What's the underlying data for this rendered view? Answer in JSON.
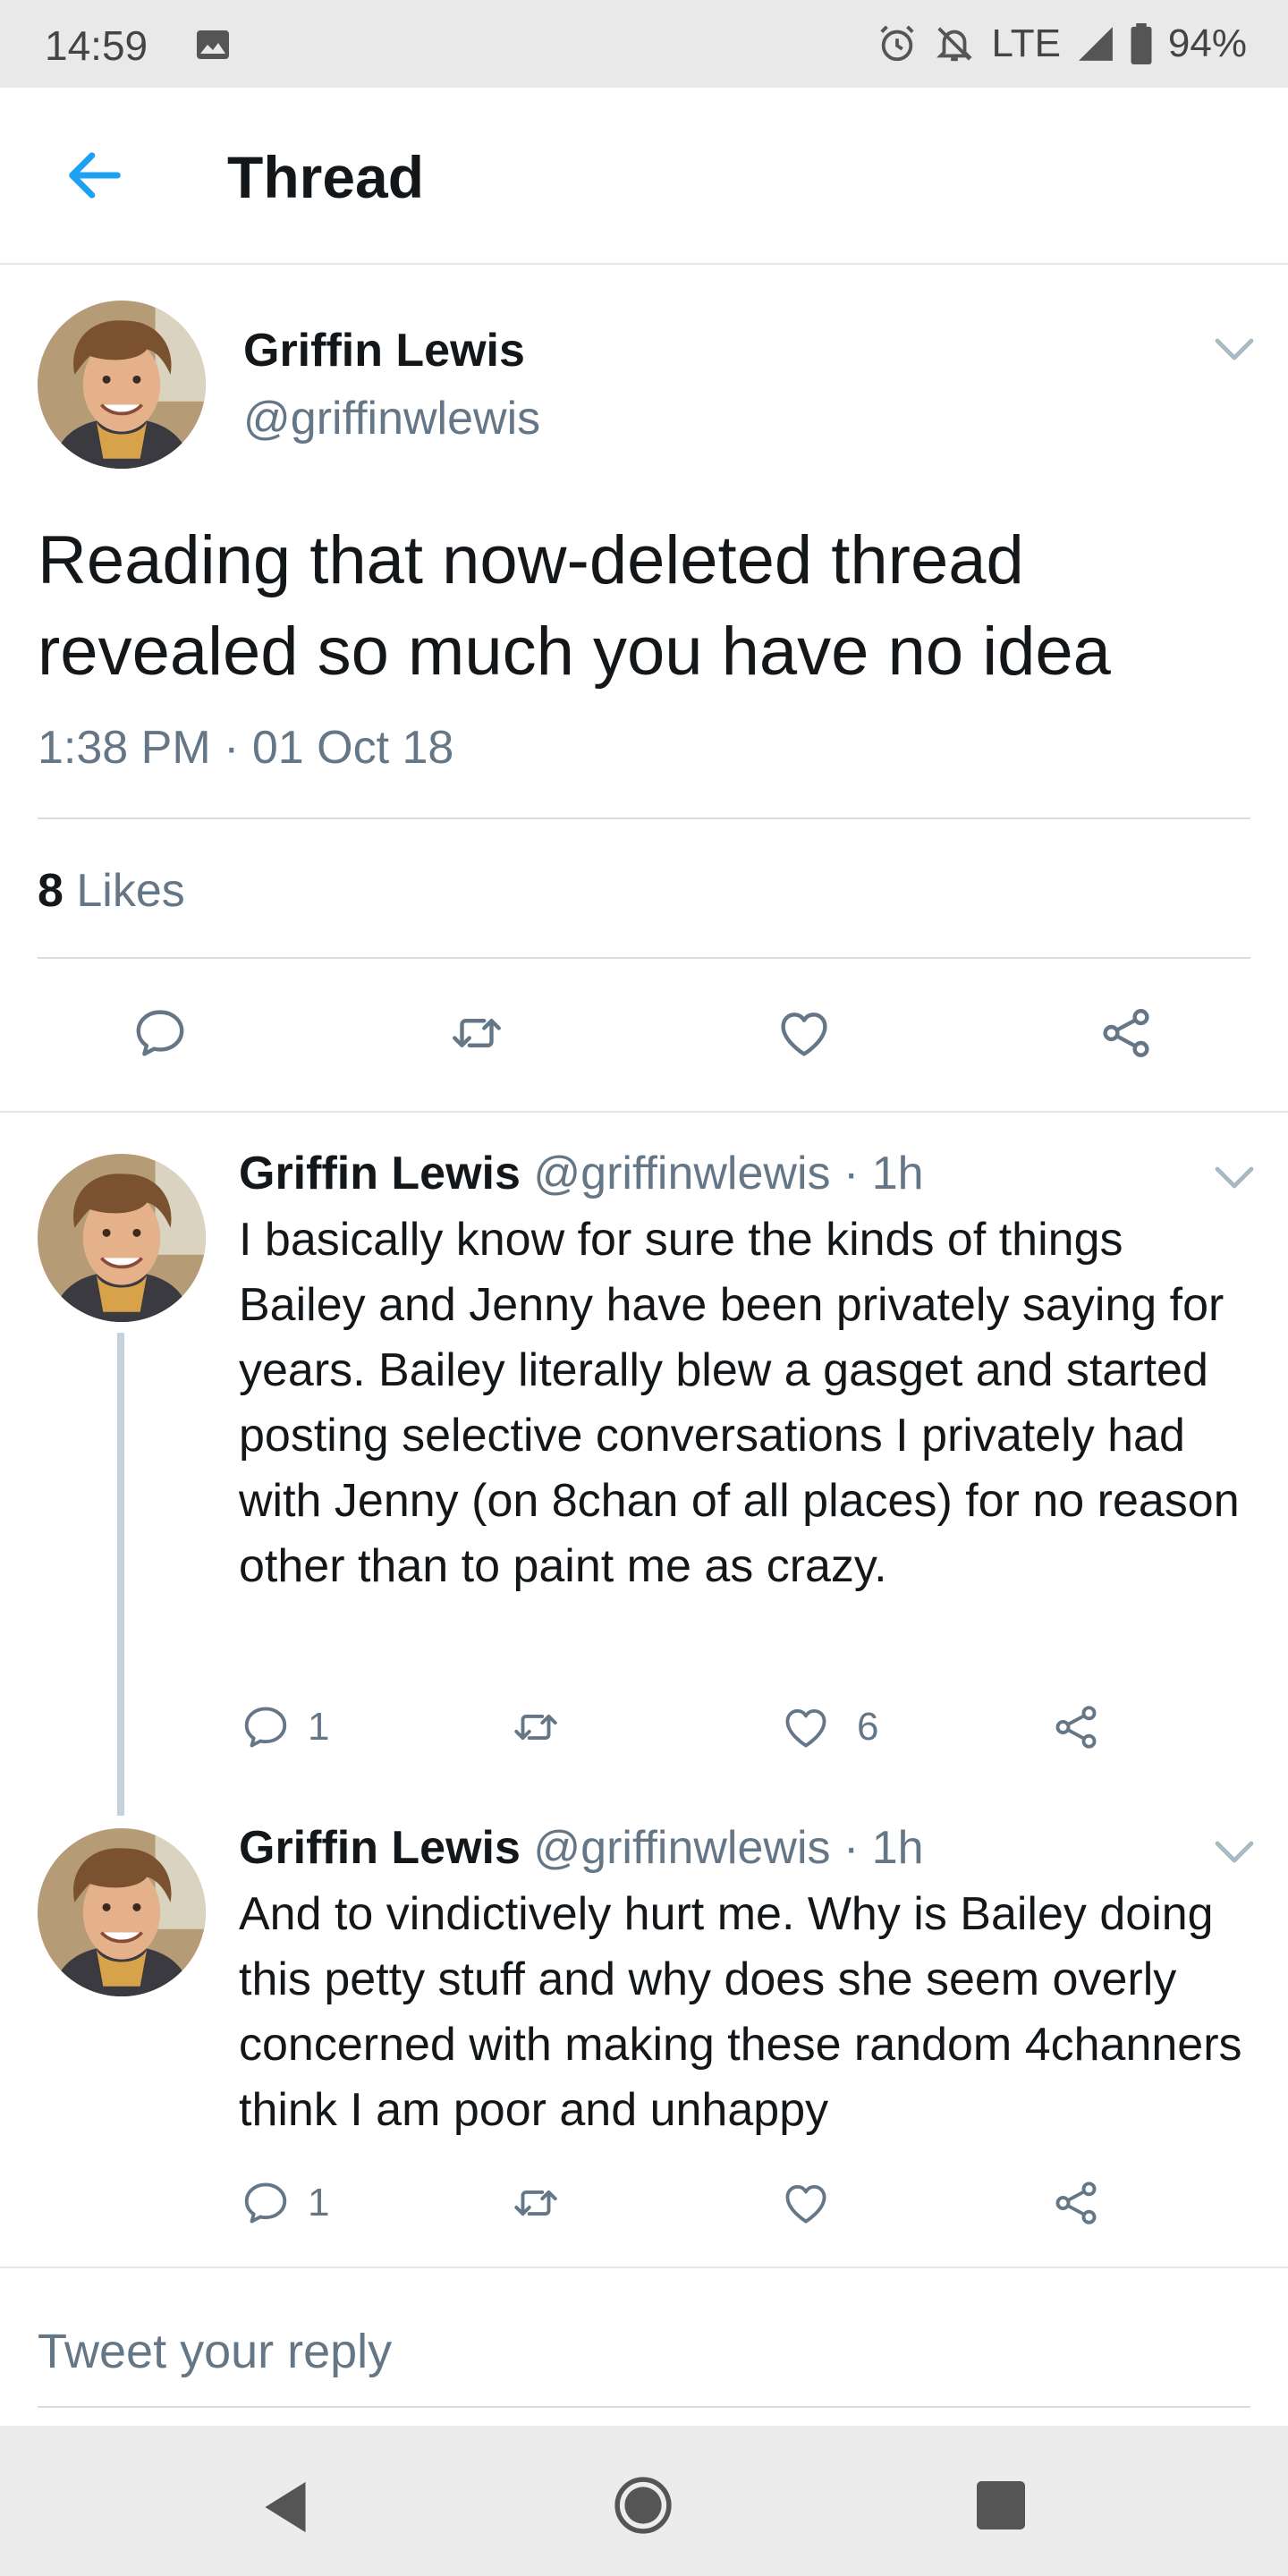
{
  "status_bar": {
    "time": "14:59",
    "network": "LTE",
    "battery": "94%"
  },
  "app_bar": {
    "title": "Thread"
  },
  "main_tweet": {
    "name": "Griffin Lewis",
    "handle": "@griffinwlewis",
    "text": "Reading that now-deleted thread revealed so much you have no idea",
    "timestamp": "1:38 PM · 01 Oct 18",
    "likes_count": "8",
    "likes_label": "Likes"
  },
  "replies": [
    {
      "name": "Griffin Lewis",
      "handle": "@griffinwlewis",
      "time": "· 1h",
      "text": "I basically know for sure the kinds of things Bailey and Jenny have been privately saying for years. Bailey literally blew a gasget and started posting selective conversations I privately had with Jenny (on 8chan of all places) for no reason other than to paint me as crazy.",
      "reply_count": "1",
      "like_count": "6"
    },
    {
      "name": "Griffin Lewis",
      "handle": "@griffinwlewis",
      "time": "· 1h",
      "text": "And to vindictively hurt me. Why is Bailey doing this petty stuff and why does she seem overly concerned with making these random 4channers think I am poor and unhappy",
      "reply_count": "1",
      "like_count": ""
    }
  ],
  "compose": {
    "placeholder": "Tweet your reply"
  },
  "colors": {
    "accent": "#1da1f2",
    "muted": "#657786",
    "divider": "#e1e8ed",
    "thread_line": "#c4d2de"
  },
  "icons": [
    "back-arrow-icon",
    "reply-icon",
    "retweet-icon",
    "like-icon",
    "share-icon",
    "chevron-down-icon",
    "alarm-icon",
    "bell-off-icon",
    "signal-icon",
    "battery-icon",
    "image-icon"
  ]
}
